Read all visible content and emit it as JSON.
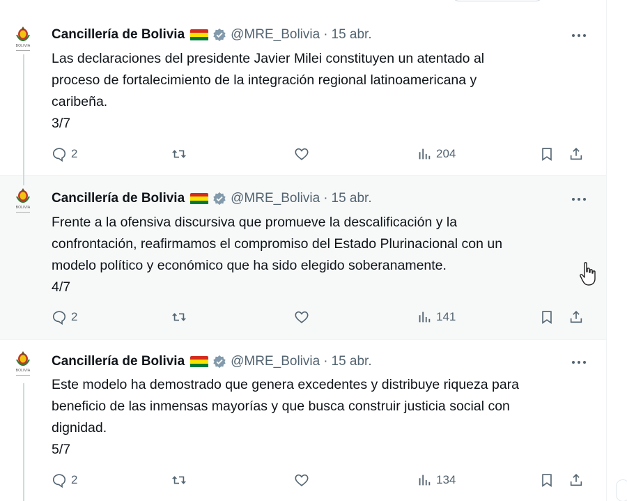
{
  "account": {
    "name": "Cancillería de Bolivia",
    "handle": "@MRE_Bolivia",
    "avatar_caption": "BOLIVIA",
    "flag_colors": [
      "#d52b1e",
      "#f9e300",
      "#007934"
    ],
    "verified_badge_color": "#829aab"
  },
  "separator": "·",
  "tweets": [
    {
      "date": "15 abr.",
      "lines": [
        "Las declaraciones del presidente Javier Milei constituyen un atentado al",
        "proceso de fortalecimiento de la integración regional latinoamericana y",
        "caribeña."
      ],
      "thread_index": "3/7",
      "replies": "2",
      "views": "204"
    },
    {
      "date": "15 abr.",
      "lines": [
        "Frente a la ofensiva discursiva que promueve la descalificación y la",
        "confrontación, reafirmamos el compromiso del Estado Plurinacional con un",
        "modelo político y económico que ha sido elegido soberanamente."
      ],
      "thread_index": "4/7",
      "replies": "2",
      "views": "141"
    },
    {
      "date": "15 abr.",
      "lines": [
        "Este modelo ha demostrado que genera excedentes y distribuye riqueza para",
        "beneficio de las inmensas mayorías y que busca construir justicia social con",
        "dignidad."
      ],
      "thread_index": "5/7",
      "replies": "2",
      "views": "134"
    }
  ],
  "icons": {
    "reply": "speech-bubble-icon",
    "retweet": "retweet-icon",
    "like": "heart-icon",
    "views": "bar-chart-icon",
    "bookmark": "bookmark-icon",
    "share": "share-icon",
    "more": "more-dots-icon"
  },
  "colors": {
    "text_primary": "#0f1419",
    "text_secondary": "#536471",
    "hover_background": "#f7f9f9",
    "border": "#eff3f4"
  }
}
